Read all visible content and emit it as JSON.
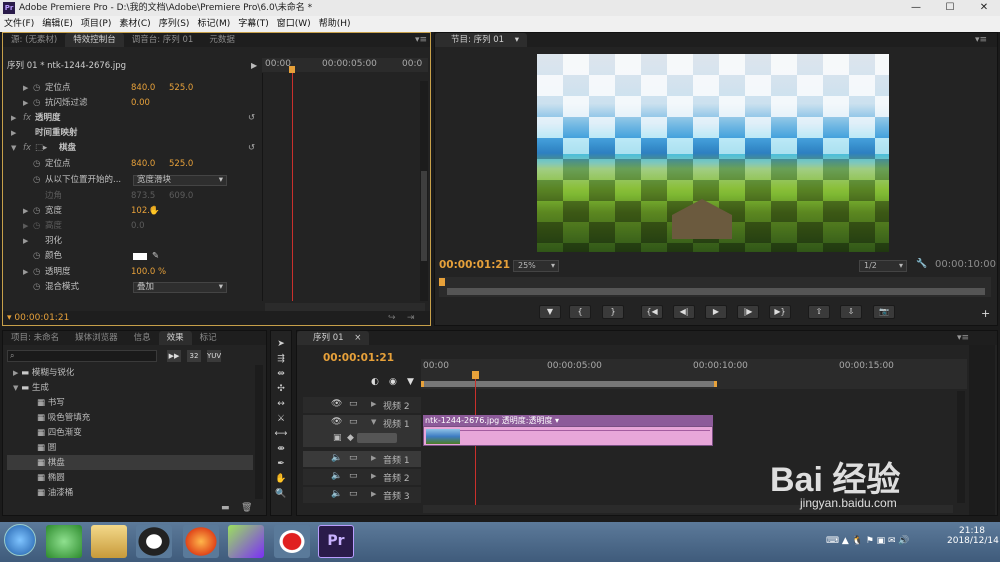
{
  "window": {
    "title": "Adobe Premiere Pro - D:\\我的文档\\Adobe\\Premiere Pro\\6.0\\未命名 *",
    "logo": "Pr"
  },
  "menu": [
    "文件(F)",
    "编辑(E)",
    "项目(P)",
    "素材(C)",
    "序列(S)",
    "标记(M)",
    "字幕(T)",
    "窗口(W)",
    "帮助(H)"
  ],
  "source_tabs": [
    "源: (无素材)",
    "特效控制台",
    "调音台: 序列 01",
    "元数据"
  ],
  "effect_controls": {
    "clip_label": "序列 01 * ntk-1244-2676.jpg",
    "ruler": [
      "00:00",
      "00:00:05:00",
      "00:0"
    ],
    "rows": [
      {
        "name": "定位点",
        "v1": "840.0",
        "v2": "525.0"
      },
      {
        "name": "抗闪烁过滤",
        "v1": "0.00"
      },
      {
        "name": "透明度"
      },
      {
        "name": "时间重映射"
      },
      {
        "name": "棋盘"
      },
      {
        "name": "定位点",
        "v1": "840.0",
        "v2": "525.0"
      },
      {
        "name": "从以下位置开始的...",
        "v1": "宽度滑块"
      },
      {
        "name": "边角",
        "v1": "873.5",
        "v2": "609.0"
      },
      {
        "name": "宽度",
        "v1": "102.0"
      },
      {
        "name": "高度",
        "v1": "0.0"
      },
      {
        "name": "羽化"
      },
      {
        "name": "颜色"
      },
      {
        "name": "透明度",
        "v1": "100.0 %"
      },
      {
        "name": "混合模式",
        "v1": "叠加"
      }
    ],
    "timecode": "00:00:01:21"
  },
  "program": {
    "tab": "节目: 序列 01",
    "timecode": "00:00:01:21",
    "zoom": "25%",
    "quality": "1/2",
    "duration": "00:00:10:00"
  },
  "project_tabs": [
    "项目: 未命名",
    "媒体浏览器",
    "信息",
    "效果",
    "标记"
  ],
  "effects_tree": [
    {
      "label": "模糊与锐化",
      "level": 1,
      "type": "folder"
    },
    {
      "label": "生成",
      "level": 1,
      "type": "folder"
    },
    {
      "label": "书写",
      "level": 2,
      "type": "fx"
    },
    {
      "label": "吸色管填充",
      "level": 2,
      "type": "fx"
    },
    {
      "label": "四色渐变",
      "level": 2,
      "type": "fx"
    },
    {
      "label": "圆",
      "level": 2,
      "type": "fx"
    },
    {
      "label": "棋盘",
      "level": 2,
      "type": "fx"
    },
    {
      "label": "椭圆",
      "level": 2,
      "type": "fx"
    },
    {
      "label": "油漆桶",
      "level": 2,
      "type": "fx"
    }
  ],
  "sequence": {
    "tab": "序列 01",
    "timecode": "00:00:01:21",
    "ruler": [
      "00:00",
      "00:00:05:00",
      "00:00:10:00",
      "00:00:15:00"
    ],
    "tracks": {
      "v2": "视频 2",
      "v1": "视频 1",
      "a1": "音频 1",
      "a2": "音频 2",
      "a3": "音频 3"
    },
    "clip_label": "ntk-1244-2676.jpg  透明度:透明度 ▾"
  },
  "taskbar": {
    "time": "21:18",
    "date": "2018/12/14",
    "pr_label": "Pr"
  },
  "watermark": {
    "brand": "Bai 经验",
    "url": "jingyan.baidu.com"
  },
  "colors": {
    "accent": "#e7a13a",
    "clip_pink": "#e8a6d9",
    "clip_header": "#8d5b9a",
    "playhead": "#c9302c"
  }
}
